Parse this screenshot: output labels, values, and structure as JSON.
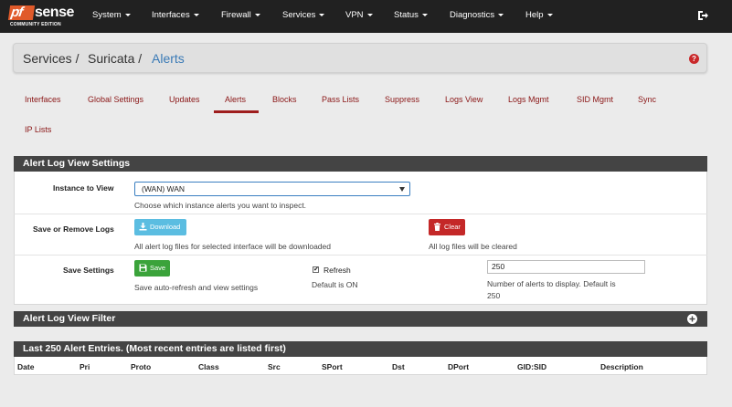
{
  "logo": {
    "text": "sense",
    "prefix": "pf",
    "subtitle": "COMMUNITY EDITION"
  },
  "nav": [
    {
      "label": "System"
    },
    {
      "label": "Interfaces"
    },
    {
      "label": "Firewall"
    },
    {
      "label": "Services"
    },
    {
      "label": "VPN"
    },
    {
      "label": "Status"
    },
    {
      "label": "Diagnostics"
    },
    {
      "label": "Help"
    }
  ],
  "breadcrumb": {
    "level1": "Services /",
    "level2": "Suricata /",
    "current": "Alerts",
    "help_glyph": "?"
  },
  "tabs": [
    {
      "label": "Interfaces"
    },
    {
      "label": "Global Settings"
    },
    {
      "label": "Updates"
    },
    {
      "label": "Alerts",
      "active": true
    },
    {
      "label": "Blocks"
    },
    {
      "label": "Pass Lists"
    },
    {
      "label": "Suppress"
    },
    {
      "label": "Logs View"
    },
    {
      "label": "Logs Mgmt"
    },
    {
      "label": "SID Mgmt"
    },
    {
      "label": "Sync"
    },
    {
      "label": "IP Lists"
    }
  ],
  "settings": {
    "title": "Alert Log View Settings",
    "instance": {
      "label": "Instance to View",
      "selected": "(WAN) WAN",
      "help": "Choose which instance alerts you want to inspect."
    },
    "save_remove": {
      "label": "Save or Remove Logs",
      "download_label": "Download",
      "download_help": "All alert log files for selected interface will be downloaded",
      "clear_label": "Clear",
      "clear_help": "All log files will be cleared"
    },
    "save_settings": {
      "label": "Save Settings",
      "save_label": "Save",
      "save_help": "Save auto-refresh and view settings",
      "refresh_label": "Refresh",
      "refresh_checked": true,
      "refresh_check_glyph": "✔",
      "refresh_help": "Default is ON",
      "count_value": "250",
      "count_help_line1": "Number of alerts to display. Default is",
      "count_help_line2": "250"
    }
  },
  "filter": {
    "title": "Alert Log View Filter"
  },
  "entries": {
    "title": "Last 250 Alert Entries. (Most recent entries are listed first)",
    "columns": [
      "Date",
      "Pri",
      "Proto",
      "Class",
      "Src",
      "SPort",
      "Dst",
      "DPort",
      "GID:SID",
      "Description"
    ]
  },
  "colors": {
    "navbar": "#212121",
    "tab_text": "#8a1515",
    "active_tab_underline": "#9e1d1d",
    "breadcrumb_active": "#3a7ab6",
    "panel_header": "#444444",
    "btn_download": "#5bbde1",
    "btn_clear": "#c42828",
    "btn_save": "#3ba33b"
  }
}
